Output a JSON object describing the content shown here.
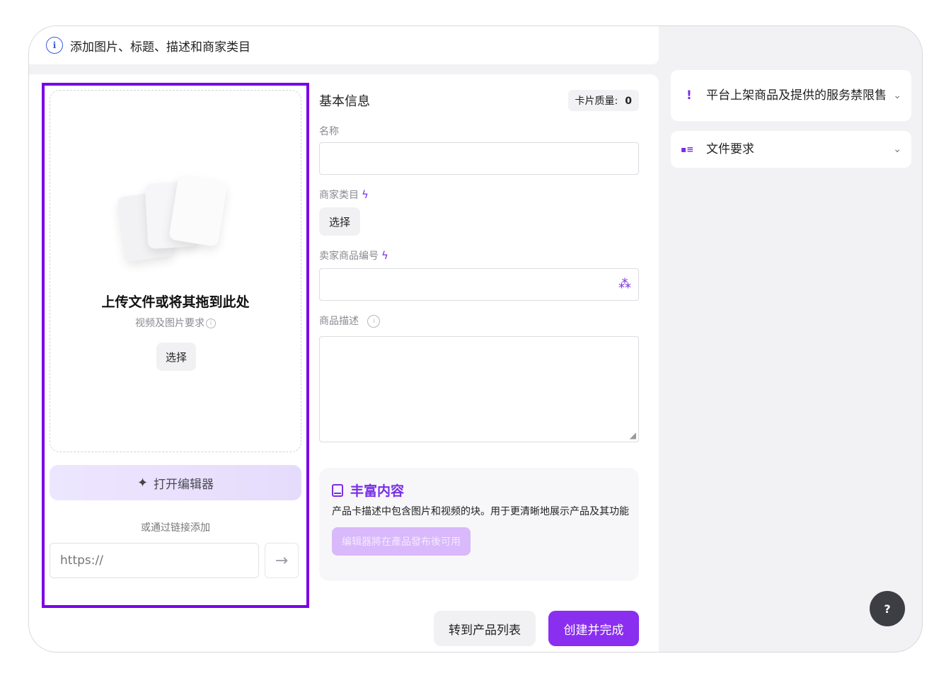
{
  "topbar": {
    "title": "添加图片、标题、描述和商家类目"
  },
  "upload": {
    "title": "上传文件或将其拖到此处",
    "subtitle": "视频及图片要求",
    "choose_label": "选择",
    "editor_label": "打开编辑器",
    "or_link_label": "或通过链接添加",
    "url_placeholder": "https://",
    "go_icon": "arrow-right-icon"
  },
  "form": {
    "section_title": "基本信息",
    "quality_label": "卡片质量:",
    "quality_value": "0",
    "name_label": "名称",
    "name_value": "",
    "category_label": "商家类目",
    "category_button": "选择",
    "sku_label": "卖家商品编号",
    "sku_value": "",
    "description_label": "商品描述",
    "description_value": ""
  },
  "rich_content": {
    "title": "丰富内容",
    "description": "产品卡描述中包含图片和视频的块。用于更清晰地展示产品及其功能",
    "button_label": "编辑器將在產品發布後可用"
  },
  "footer": {
    "to_list_label": "转到产品列表",
    "create_label": "创建并完成"
  },
  "sidebar": {
    "items": [
      {
        "label": "平台上架商品及提供的服务禁限售",
        "icon": "exclamation-icon"
      },
      {
        "label": "文件要求",
        "icon": "document-list-icon"
      }
    ]
  },
  "help": {
    "label": "?"
  },
  "colors": {
    "accent": "#7a00e6",
    "primary_button": "#8a2ef0",
    "info": "#3b5bdb"
  }
}
